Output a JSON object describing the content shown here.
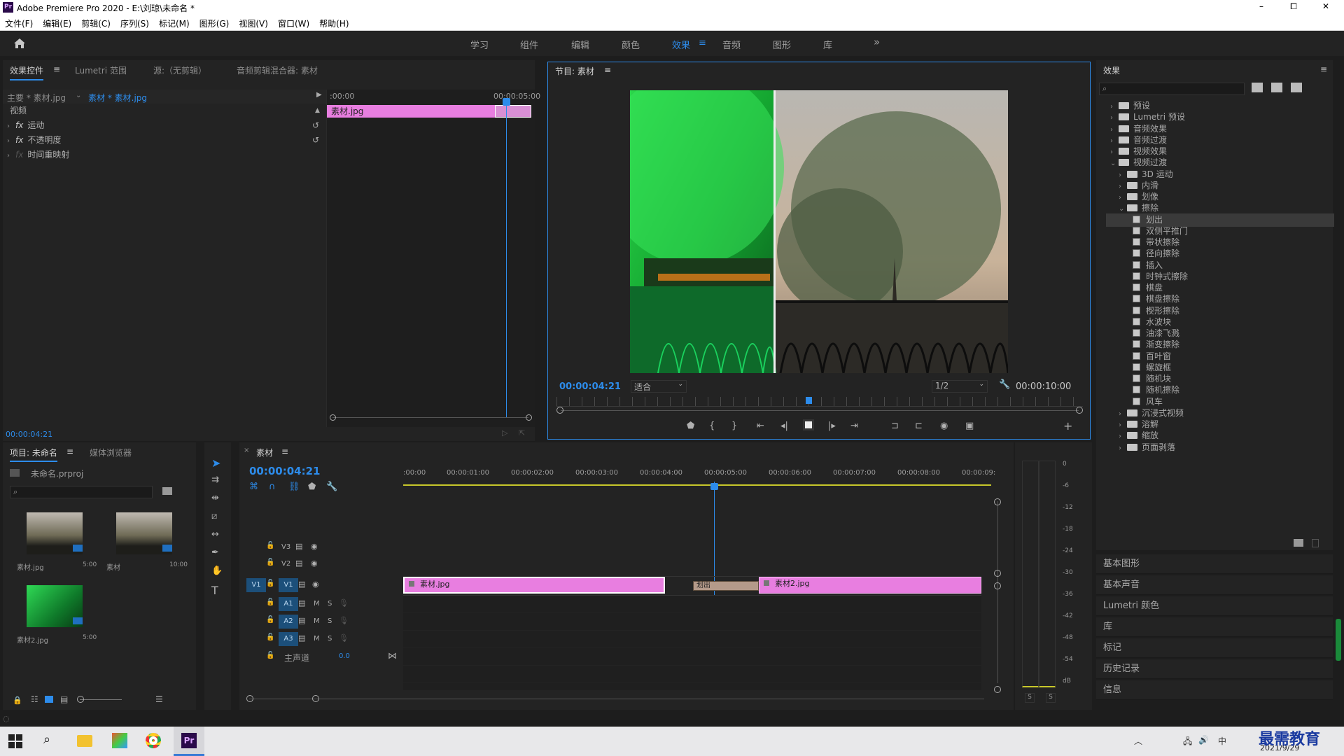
{
  "window": {
    "title": "Adobe Premiere Pro 2020 - E:\\刘琼\\未命名 *",
    "app_icon": "Pr",
    "controls": {
      "minimize": "–",
      "maximize": "⧠",
      "close": "✕"
    }
  },
  "menu": [
    "文件(F)",
    "编辑(E)",
    "剪辑(C)",
    "序列(S)",
    "标记(M)",
    "图形(G)",
    "视图(V)",
    "窗口(W)",
    "帮助(H)"
  ],
  "workspaces": {
    "items": [
      "学习",
      "组件",
      "编辑",
      "颜色",
      "效果",
      "音频",
      "图形",
      "库"
    ],
    "active": "效果",
    "more": "»"
  },
  "effect_controls": {
    "tabs": [
      "效果控件",
      "Lumetri 范围",
      "源:（无剪辑）",
      "音频剪辑混合器: 素材"
    ],
    "active_tab": "效果控件",
    "master_label": "主要 * 素材.jpg",
    "clip_label": "素材 * 素材.jpg",
    "section": "视频",
    "effects": [
      "运动",
      "不透明度",
      "时间重映射"
    ],
    "ruler_start": ":00:00",
    "ruler_end": "00:00:05:00",
    "clip_name": "素材.jpg",
    "timecode": "00:00:04:21"
  },
  "program": {
    "tab": "节目: 素材",
    "timecode": "00:00:04:21",
    "fit": "适合",
    "resolution": "1/2",
    "duration": "00:00:10:00"
  },
  "project": {
    "tabs": [
      "项目: 未命名",
      "媒体浏览器"
    ],
    "file": "未命名.prproj",
    "items": [
      {
        "name": "素材.jpg",
        "duration": "5:00"
      },
      {
        "name": "素材",
        "duration": "10:00"
      },
      {
        "name": "素材2.jpg",
        "duration": "5:00"
      }
    ]
  },
  "timeline": {
    "tab": "素材",
    "timecode": "00:00:04:21",
    "ruler": [
      ":00:00",
      "00:00:01:00",
      "00:00:02:00",
      "00:00:03:00",
      "00:00:04:00",
      "00:00:05:00",
      "00:00:06:00",
      "00:00:07:00",
      "00:00:08:00",
      "00:00:09:"
    ],
    "video_tracks": [
      "V3",
      "V2",
      "V1"
    ],
    "audio_tracks": [
      "A1",
      "A2",
      "A3"
    ],
    "source_patch": "V1",
    "master": "主声道",
    "master_value": "0.0",
    "clips": [
      {
        "name": "素材.jpg"
      },
      {
        "name": "素材2.jpg"
      }
    ],
    "transition": "划出",
    "mute": "M",
    "solo": "S"
  },
  "meter": {
    "scale": [
      "0",
      "-6",
      "-12",
      "-18",
      "-24",
      "-30",
      "-36",
      "-42",
      "-48",
      "-54",
      "dB"
    ],
    "solo": [
      "S",
      "S"
    ]
  },
  "effects_panel": {
    "title": "效果",
    "tree": [
      {
        "label": "预设",
        "level": 0,
        "type": "folder",
        "open": false
      },
      {
        "label": "Lumetri 预设",
        "level": 0,
        "type": "folder",
        "open": false
      },
      {
        "label": "音频效果",
        "level": 0,
        "type": "folder",
        "open": false
      },
      {
        "label": "音频过渡",
        "level": 0,
        "type": "folder",
        "open": false
      },
      {
        "label": "视频效果",
        "level": 0,
        "type": "folder",
        "open": false
      },
      {
        "label": "视频过渡",
        "level": 0,
        "type": "folder",
        "open": true
      },
      {
        "label": "3D 运动",
        "level": 1,
        "type": "folder",
        "open": false
      },
      {
        "label": "内滑",
        "level": 1,
        "type": "folder",
        "open": false
      },
      {
        "label": "划像",
        "level": 1,
        "type": "folder",
        "open": false
      },
      {
        "label": "擦除",
        "level": 1,
        "type": "folder",
        "open": true
      },
      {
        "label": "划出",
        "level": 2,
        "type": "effect",
        "selected": true
      },
      {
        "label": "双侧平推门",
        "level": 2,
        "type": "effect"
      },
      {
        "label": "带状擦除",
        "level": 2,
        "type": "effect"
      },
      {
        "label": "径向擦除",
        "level": 2,
        "type": "effect"
      },
      {
        "label": "插入",
        "level": 2,
        "type": "effect"
      },
      {
        "label": "时钟式擦除",
        "level": 2,
        "type": "effect"
      },
      {
        "label": "棋盘",
        "level": 2,
        "type": "effect"
      },
      {
        "label": "棋盘擦除",
        "level": 2,
        "type": "effect"
      },
      {
        "label": "楔形擦除",
        "level": 2,
        "type": "effect"
      },
      {
        "label": "水波块",
        "level": 2,
        "type": "effect"
      },
      {
        "label": "油漆飞溅",
        "level": 2,
        "type": "effect"
      },
      {
        "label": "渐变擦除",
        "level": 2,
        "type": "effect"
      },
      {
        "label": "百叶窗",
        "level": 2,
        "type": "effect"
      },
      {
        "label": "螺旋框",
        "level": 2,
        "type": "effect"
      },
      {
        "label": "随机块",
        "level": 2,
        "type": "effect"
      },
      {
        "label": "随机擦除",
        "level": 2,
        "type": "effect"
      },
      {
        "label": "风车",
        "level": 2,
        "type": "effect"
      },
      {
        "label": "沉浸式视频",
        "level": 1,
        "type": "folder",
        "open": false
      },
      {
        "label": "溶解",
        "level": 1,
        "type": "folder",
        "open": false
      },
      {
        "label": "缩放",
        "level": 1,
        "type": "folder",
        "open": false
      },
      {
        "label": "页面剥落",
        "level": 1,
        "type": "folder",
        "open": false
      }
    ],
    "collapsed_panels": [
      "基本图形",
      "基本声音",
      "Lumetri 颜色",
      "库",
      "标记",
      "历史记录",
      "信息"
    ]
  },
  "taskbar": {
    "date": "2021/9/29",
    "ime": "中",
    "watermark": "最需教育"
  }
}
